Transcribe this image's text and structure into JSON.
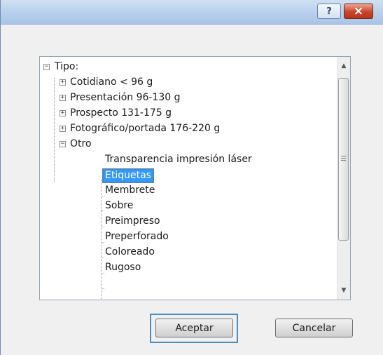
{
  "titlebar": {
    "help_label": "?",
    "close_label": "×"
  },
  "tree": {
    "root": "Tipo:",
    "groups": [
      "Cotidiano < 96 g",
      "Presentación 96-130 g",
      "Prospecto 131-175 g",
      "Fotográfico/portada 176-220 g",
      "Otro"
    ],
    "otro_items": [
      "Transparencia impresión láser",
      "Etiquetas",
      "Membrete",
      "Sobre",
      "Preimpreso",
      "Preperforado",
      "Coloreado",
      "Rugoso"
    ],
    "selected": "Etiquetas"
  },
  "buttons": {
    "ok_label": "Aceptar",
    "cancel_label": "Cancelar"
  }
}
